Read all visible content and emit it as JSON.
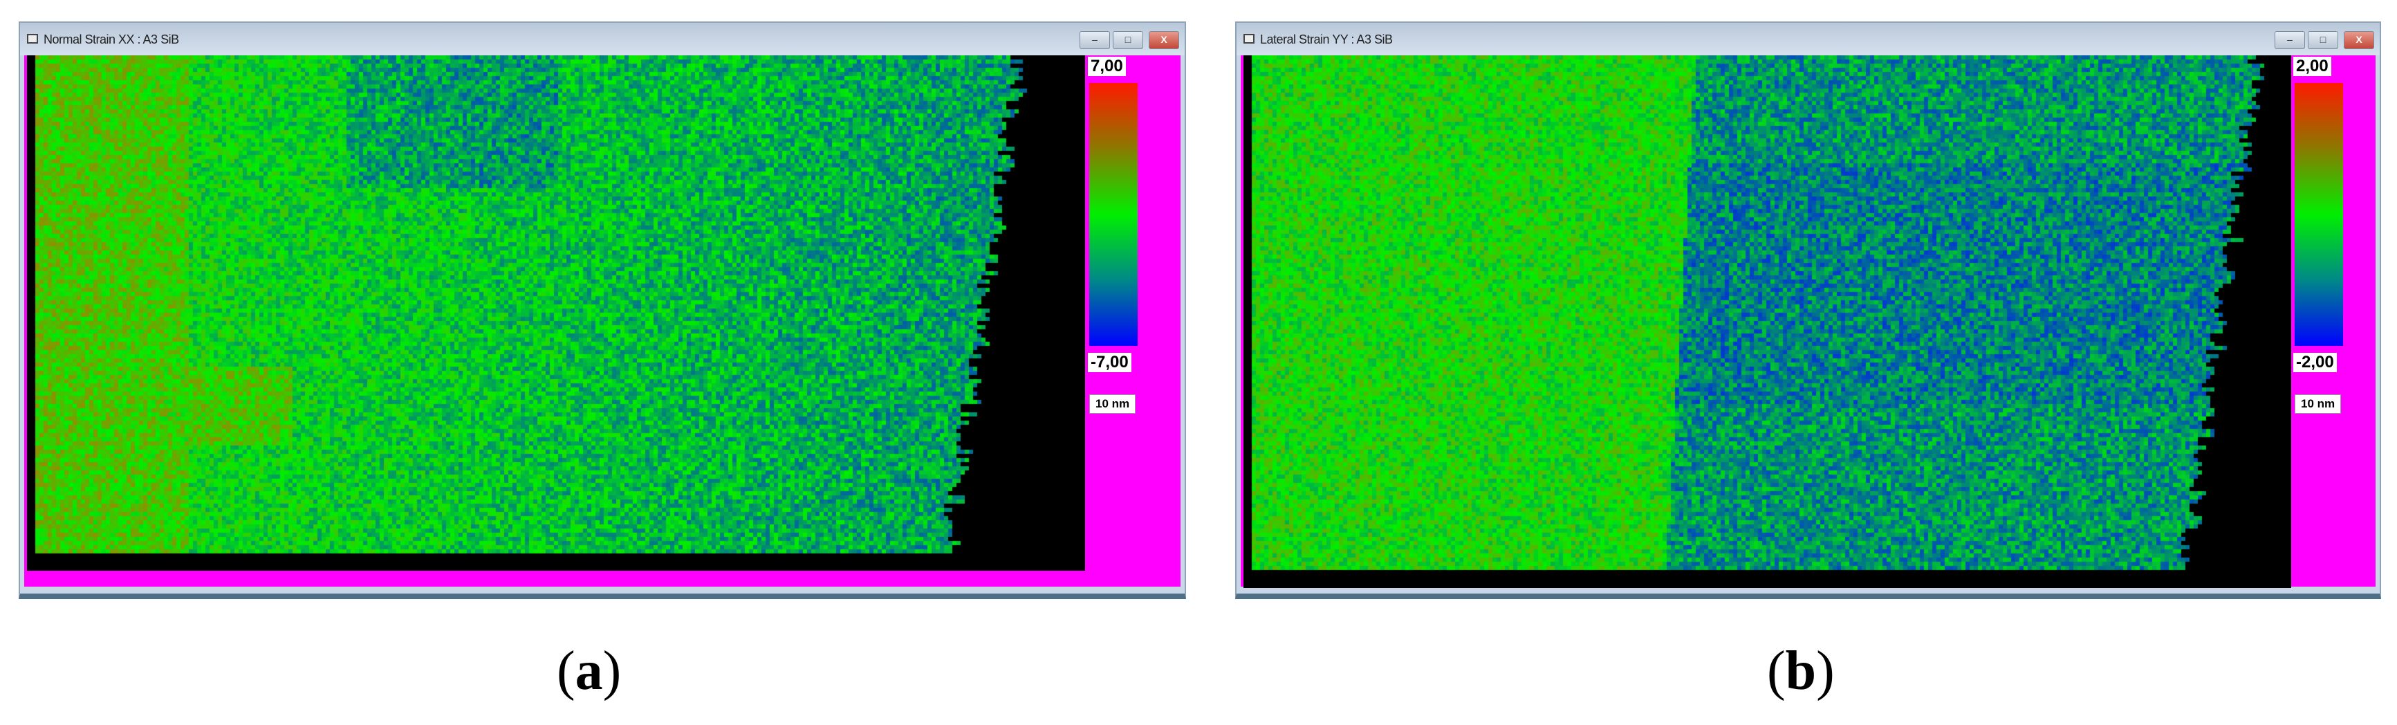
{
  "panels": [
    {
      "title": "Normal Strain XX : A3 SiB",
      "max": "7,00",
      "min": "-7,00",
      "scale": "10 nm",
      "caption_letter": "a"
    },
    {
      "title": "Lateral Strain YY : A3 SiB",
      "max": "2,00",
      "min": "-2,00",
      "scale": "10 nm",
      "caption_letter": "b"
    }
  ],
  "window_buttons": {
    "minimize": "–",
    "maximize": "□",
    "close": "X"
  },
  "caption": {
    "open": "(",
    "close": ")"
  }
}
